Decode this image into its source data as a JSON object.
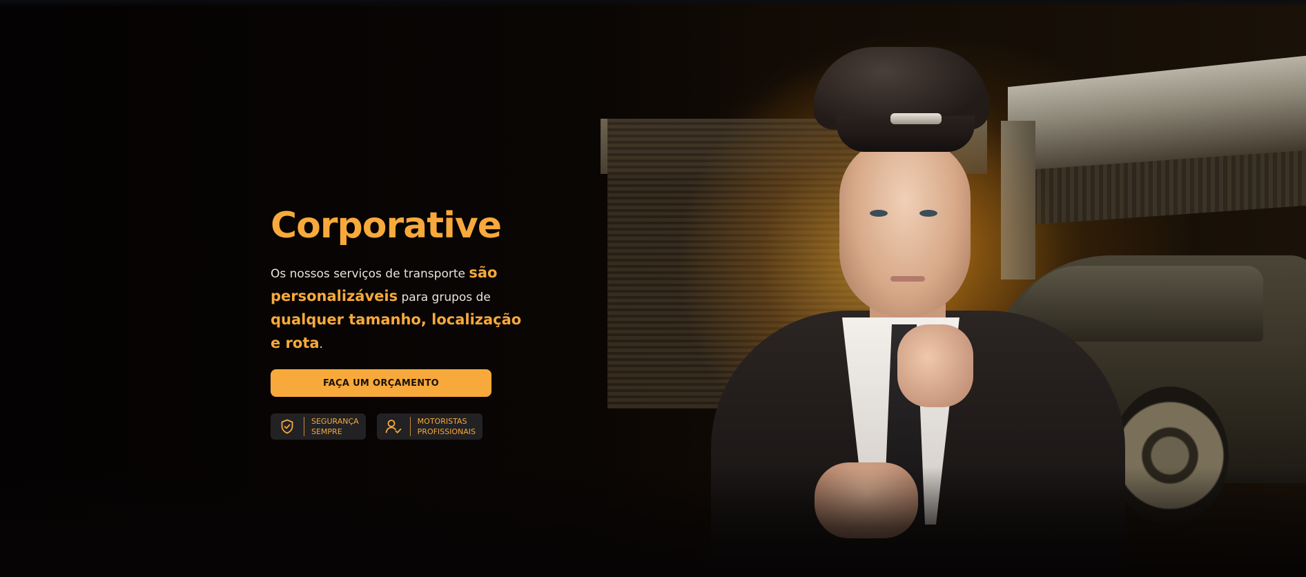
{
  "hero": {
    "title": "Corporative",
    "description": {
      "part1": "Os nossos serviços de transporte ",
      "highlight1": "são personalizáveis",
      "part2": " para grupos de ",
      "highlight2": "qualquer tamanho, localização e rota",
      "part3": "."
    },
    "cta_label": "FAÇA UM ORÇAMENTO",
    "badges": [
      {
        "icon": "shield-check-icon",
        "line1": "SEGURANÇA",
        "line2": "SEMPRE"
      },
      {
        "icon": "user-check-icon",
        "line1": "MOTORISTAS",
        "line2": "PROFISSIONAIS"
      }
    ]
  },
  "colors": {
    "accent": "#f7a93b",
    "background": "#050303",
    "badge_bg": "#222124",
    "text": "#e9e4dc"
  }
}
